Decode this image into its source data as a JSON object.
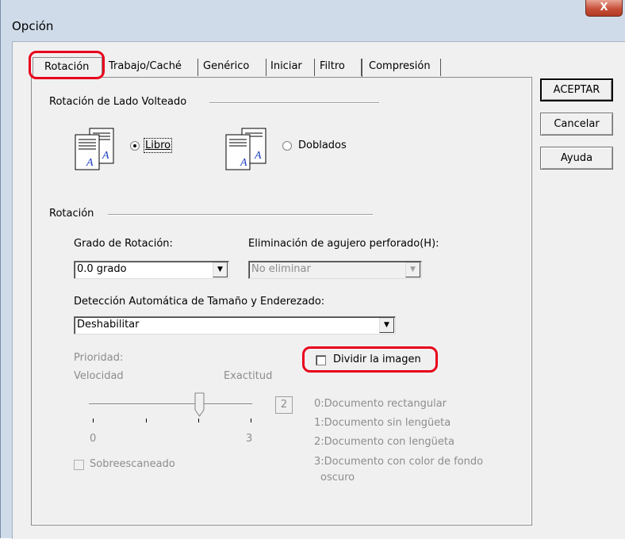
{
  "window": {
    "title": "Opción",
    "close_label": "X"
  },
  "tabs": [
    {
      "label": "Rotación",
      "active": true
    },
    {
      "label": "Trabajo/Caché"
    },
    {
      "label": "Genérico"
    },
    {
      "label": "Iniciar"
    },
    {
      "label": "Filtro"
    },
    {
      "label": "Compresión"
    }
  ],
  "buttons": {
    "ok": "ACEPTAR",
    "cancel": "Cancelar",
    "help": "Ayuda"
  },
  "flip_rotation": {
    "group_label": "Rotación de Lado Volteado",
    "option_book": "Libro",
    "option_fold": "Doblados",
    "selected": "Libro"
  },
  "rotation": {
    "group_label": "Rotación",
    "degree_label": "Grado de Rotación:",
    "degree_value": "0.0 grado",
    "punch_label": "Eliminación de agujero perforado(H):",
    "punch_value": "No eliminar",
    "auto_detect_label": "Detección Automática de Tamaño y Enderezado:",
    "auto_detect_value": "Deshabilitar",
    "split_image_label": "Dividir la imagen",
    "priority_label": "Prioridad:",
    "speed_label": "Velocidad",
    "accuracy_label": "Exactitud",
    "slider_min": "0",
    "slider_max": "3",
    "slider_value": "2",
    "overscan_label": "Sobreescaneado",
    "legend": [
      "0:Documento rectangular",
      "1:Documento sin lengüeta",
      "2:Documento con lengüeta",
      "3:Documento con color de fondo",
      "oscuro"
    ]
  },
  "colors": {
    "highlight": "#e8001c",
    "frame": "#cfdbe9",
    "close": "#c7503a"
  }
}
